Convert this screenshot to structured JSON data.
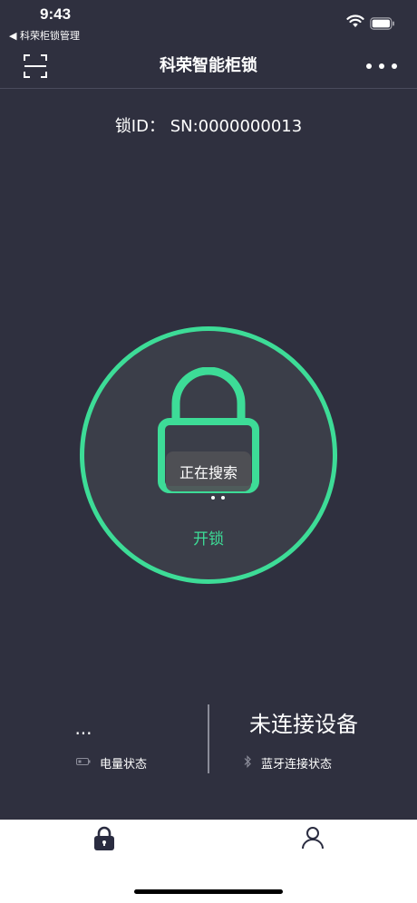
{
  "status_bar": {
    "time": "9:43",
    "back_app": "◀ 科荣柜锁管理"
  },
  "nav": {
    "title": "科荣智能柜锁",
    "scan_icon": "scan-icon",
    "more_icon": "more-icon"
  },
  "lock": {
    "id_text": "锁ID：  SN:0000000013",
    "toast": "正在搜索",
    "unlock_label": "开锁"
  },
  "stats": {
    "battery_value": "...",
    "battery_label": "电量状态",
    "connection_value": "未连接设备",
    "bluetooth_label": "蓝牙连接状态"
  },
  "colors": {
    "background": "#2f303f",
    "accent": "#3ddc97",
    "tabbar": "#ffffff"
  },
  "tabs": {
    "items": [
      {
        "icon": "lock-icon",
        "active": true
      },
      {
        "icon": "user-icon",
        "active": false
      }
    ]
  }
}
